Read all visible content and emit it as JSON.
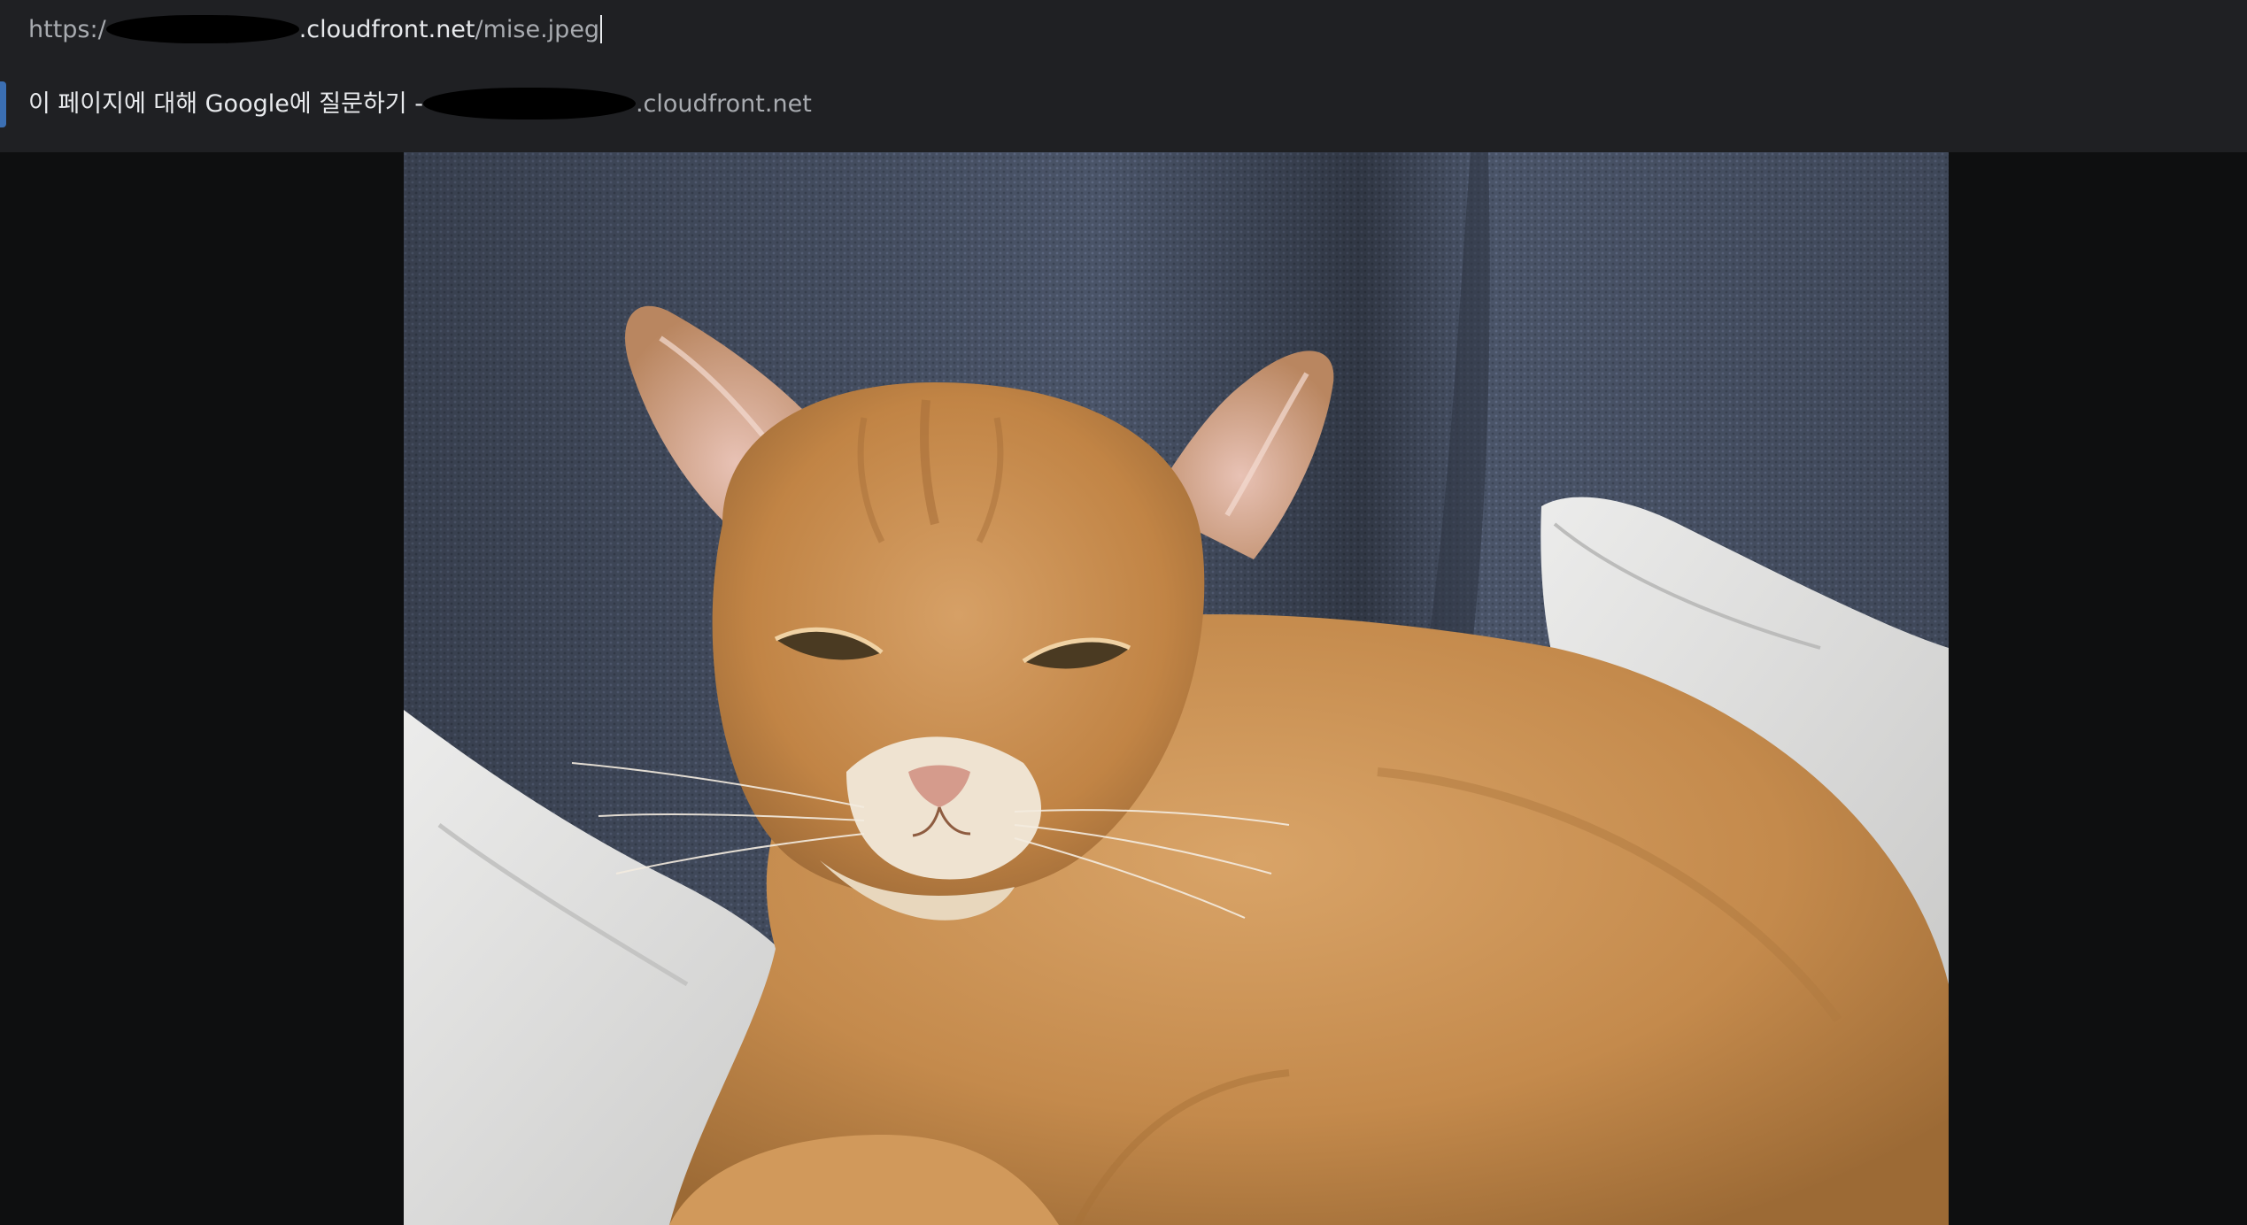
{
  "address_bar": {
    "scheme": "https:/",
    "host_suffix": ".cloudfront.net",
    "path": "/mise.jpeg"
  },
  "suggestion": {
    "label": "이 페이지에 대해 Google에 질문하기 -",
    "domain_suffix": ".cloudfront.net"
  },
  "image": {
    "filename": "mise.jpeg"
  },
  "colors": {
    "omnibox_bg": "#1f2023",
    "page_bg": "#0e0f10",
    "selection_accent": "#3b6fb3"
  }
}
